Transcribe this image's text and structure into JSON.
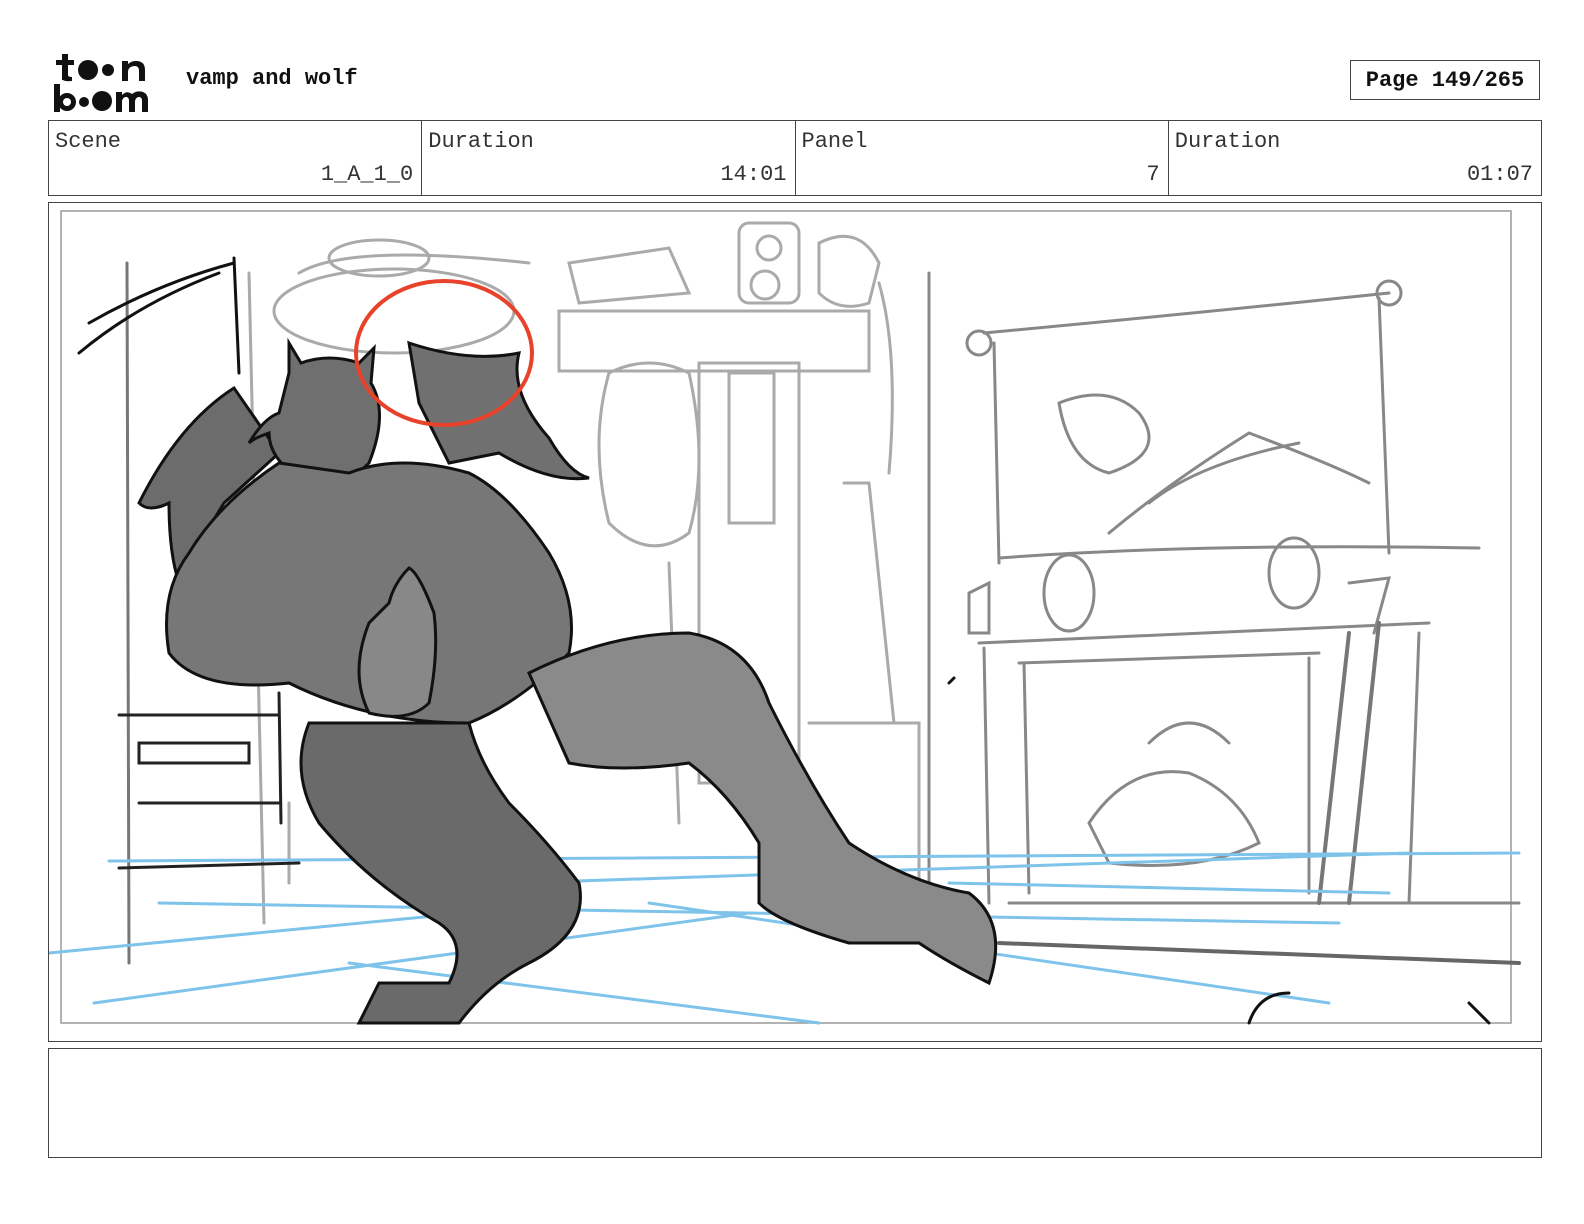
{
  "header": {
    "logo_alt": "toon boom",
    "project_title": "vamp and wolf",
    "page_label": "Page 149/265"
  },
  "info": {
    "scene_label": "Scene",
    "scene_value": "1_A_1_0",
    "scene_duration_label": "Duration",
    "scene_duration_value": "14:01",
    "panel_label": "Panel",
    "panel_value": "7",
    "panel_duration_label": "Duration",
    "panel_duration_value": "01:07"
  },
  "notes": {
    "text": ""
  },
  "colors": {
    "border": "#444444",
    "sketch_light": "#aaaaaa",
    "sketch_mid": "#888888",
    "character_fill": "#707070",
    "floor_lines": "#7ec3ea",
    "action_circle": "#e8432a"
  }
}
